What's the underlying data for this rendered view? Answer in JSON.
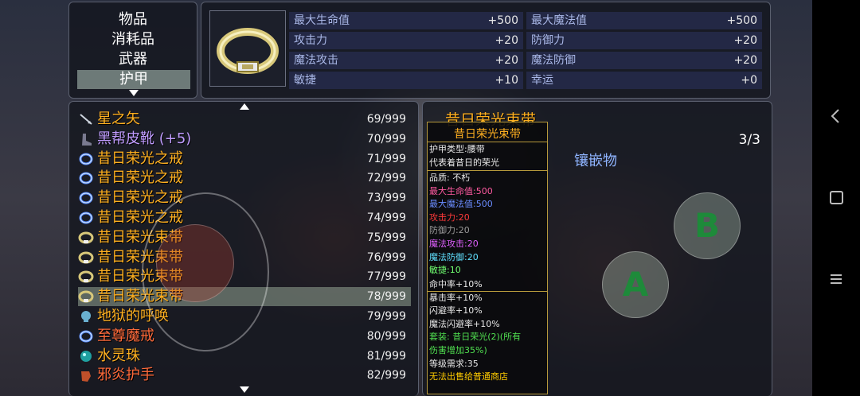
{
  "categories": [
    {
      "label": "物品",
      "selected": false
    },
    {
      "label": "消耗品",
      "selected": false
    },
    {
      "label": "武器",
      "selected": false
    },
    {
      "label": "护甲",
      "selected": true
    }
  ],
  "stats": [
    {
      "name": "最大生命值",
      "value": "+500"
    },
    {
      "name": "最大魔法值",
      "value": "+500"
    },
    {
      "name": "攻击力",
      "value": "+20"
    },
    {
      "name": "防御力",
      "value": "+20"
    },
    {
      "name": "魔法攻击",
      "value": "+20"
    },
    {
      "name": "魔法防御",
      "value": "+20"
    },
    {
      "name": "敏捷",
      "value": "+10"
    },
    {
      "name": "幸运",
      "value": "+0"
    }
  ],
  "items": [
    {
      "name": "星之矢",
      "count": "69/999",
      "color": "#ffb020",
      "icon": "arrow-icon"
    },
    {
      "name": "黑帮皮靴 (+5)",
      "count": "70/999",
      "color": "#c09cff",
      "icon": "boot-icon"
    },
    {
      "name": "昔日荣光之戒",
      "count": "71/999",
      "color": "#ffb020",
      "icon": "ring-icon"
    },
    {
      "name": "昔日荣光之戒",
      "count": "72/999",
      "color": "#ffb020",
      "icon": "ring-icon"
    },
    {
      "name": "昔日荣光之戒",
      "count": "73/999",
      "color": "#ffb020",
      "icon": "ring-icon"
    },
    {
      "name": "昔日荣光之戒",
      "count": "74/999",
      "color": "#ffb020",
      "icon": "ring-icon"
    },
    {
      "name": "昔日荣光束带",
      "count": "75/999",
      "color": "#ffb020",
      "icon": "belt-icon"
    },
    {
      "name": "昔日荣光束带",
      "count": "76/999",
      "color": "#ffb020",
      "icon": "belt-icon"
    },
    {
      "name": "昔日荣光束带",
      "count": "77/999",
      "color": "#ffb020",
      "icon": "belt-icon"
    },
    {
      "name": "昔日荣光束带",
      "count": "78/999",
      "color": "#ffb020",
      "icon": "belt-icon",
      "selected": true
    },
    {
      "name": "地狱的呼唤",
      "count": "79/999",
      "color": "#ffb020",
      "icon": "skull-icon"
    },
    {
      "name": "至尊魔戒",
      "count": "80/999",
      "color": "#ff6a3a",
      "icon": "ring-icon"
    },
    {
      "name": "水灵珠",
      "count": "81/999",
      "color": "#ffb020",
      "icon": "orb-icon"
    },
    {
      "name": "邪炎护手",
      "count": "82/999",
      "color": "#ff6a3a",
      "icon": "gauntlet-icon"
    }
  ],
  "detail": {
    "title": "昔日荣光束带",
    "socket_label": "镶嵌物",
    "socket_count": "3/3"
  },
  "tooltip": {
    "title": "昔日荣光束带",
    "lines_a": [
      {
        "text": "护甲类型:腰带",
        "color": "#e8e8e8"
      },
      {
        "text": "代表着昔日的荣光",
        "color": "#e8e8e8"
      }
    ],
    "lines_b": [
      {
        "text": "品质: 不朽",
        "color": "#e8e8e8"
      },
      {
        "text": "最大生命值:500",
        "color": "#ff5aa0"
      },
      {
        "text": "最大魔法值:500",
        "color": "#6a8cff"
      },
      {
        "text": "攻击力:20",
        "color": "#ff3a3a"
      },
      {
        "text": "防御力:20",
        "color": "#9a9a9a"
      },
      {
        "text": "魔法攻击:20",
        "color": "#e060ff"
      },
      {
        "text": "魔法防御:20",
        "color": "#60e0ff"
      },
      {
        "text": "敏捷:10",
        "color": "#70ff70"
      }
    ],
    "lines_c": [
      {
        "text": "命中率+10%",
        "color": "#e8e8e8"
      },
      {
        "text": "暴击率+10%",
        "color": "#e8e8e8"
      },
      {
        "text": "闪避率+10%",
        "color": "#e8e8e8"
      },
      {
        "text": "魔法闪避率+10%",
        "color": "#e8e8e8"
      },
      {
        "text": "套装: 昔日荣光(2)(所有",
        "color": "#50e050"
      },
      {
        "text": "伤害增加35%)",
        "color": "#50e050"
      },
      {
        "text": "等级需求:35",
        "color": "#e8e8e8"
      },
      {
        "text": "无法出售给普通商店",
        "color": "#ffcc00"
      }
    ]
  },
  "buttons": {
    "a": "A",
    "b": "B"
  }
}
